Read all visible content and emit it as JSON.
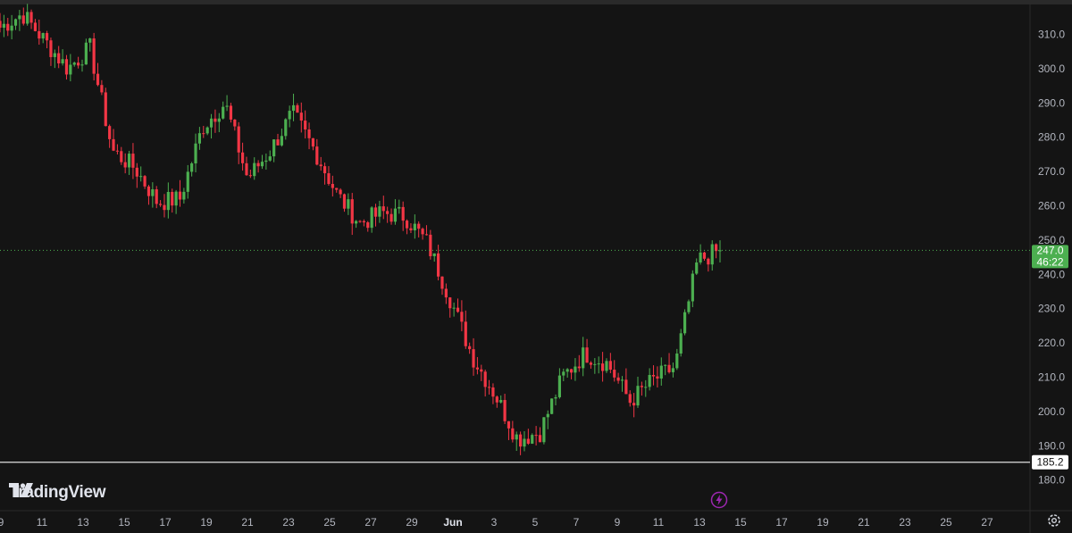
{
  "app": {
    "brand": "TradingView",
    "brand_icon": "tv-logo-icon"
  },
  "colors": {
    "up": "#4caf50",
    "down": "#f23645",
    "background": "#141414",
    "grid": "#1e1e1e",
    "last_price_line": "#4caf50",
    "level_line": "#e0e0e0"
  },
  "price_axis": {
    "ticks": [
      "310.0",
      "300.0",
      "290.0",
      "280.0",
      "270.0",
      "260.0",
      "250.0",
      "240.0",
      "230.0",
      "220.0",
      "210.0",
      "200.0",
      "190.0",
      "180.0"
    ],
    "last_price_label": "247.0",
    "countdown_label": "46:22",
    "level_label": "185.2"
  },
  "time_axis": {
    "ticks": [
      "9",
      "11",
      "13",
      "15",
      "17",
      "19",
      "21",
      "23",
      "25",
      "27",
      "29",
      "Jun",
      "3",
      "5",
      "7",
      "9",
      "11",
      "13",
      "15",
      "17",
      "19",
      "21",
      "23",
      "25",
      "27"
    ]
  },
  "icons": {
    "settings": "gear-icon",
    "alert": "lightning-icon"
  },
  "chart_data": {
    "type": "candlestick",
    "title": "",
    "ylim": [
      178,
      318
    ],
    "y_ticks": [
      310,
      300,
      290,
      280,
      270,
      260,
      250,
      240,
      230,
      220,
      210,
      200,
      190,
      180
    ],
    "last_price": 247.0,
    "horizontal_level": 185.2,
    "x": [
      "9",
      "11",
      "13",
      "15",
      "17",
      "19",
      "21",
      "23",
      "25",
      "27",
      "29",
      "Jun",
      "3",
      "5",
      "7",
      "9",
      "11",
      "13"
    ],
    "closes": [
      312,
      316,
      308,
      300,
      306,
      276,
      271,
      261,
      262,
      283,
      290,
      268,
      276,
      287,
      276,
      263,
      255,
      258,
      257,
      249,
      233,
      216,
      205,
      192,
      194,
      210,
      217,
      214,
      203,
      209,
      213,
      244,
      247
    ],
    "candle_count_estimate": 185
  }
}
